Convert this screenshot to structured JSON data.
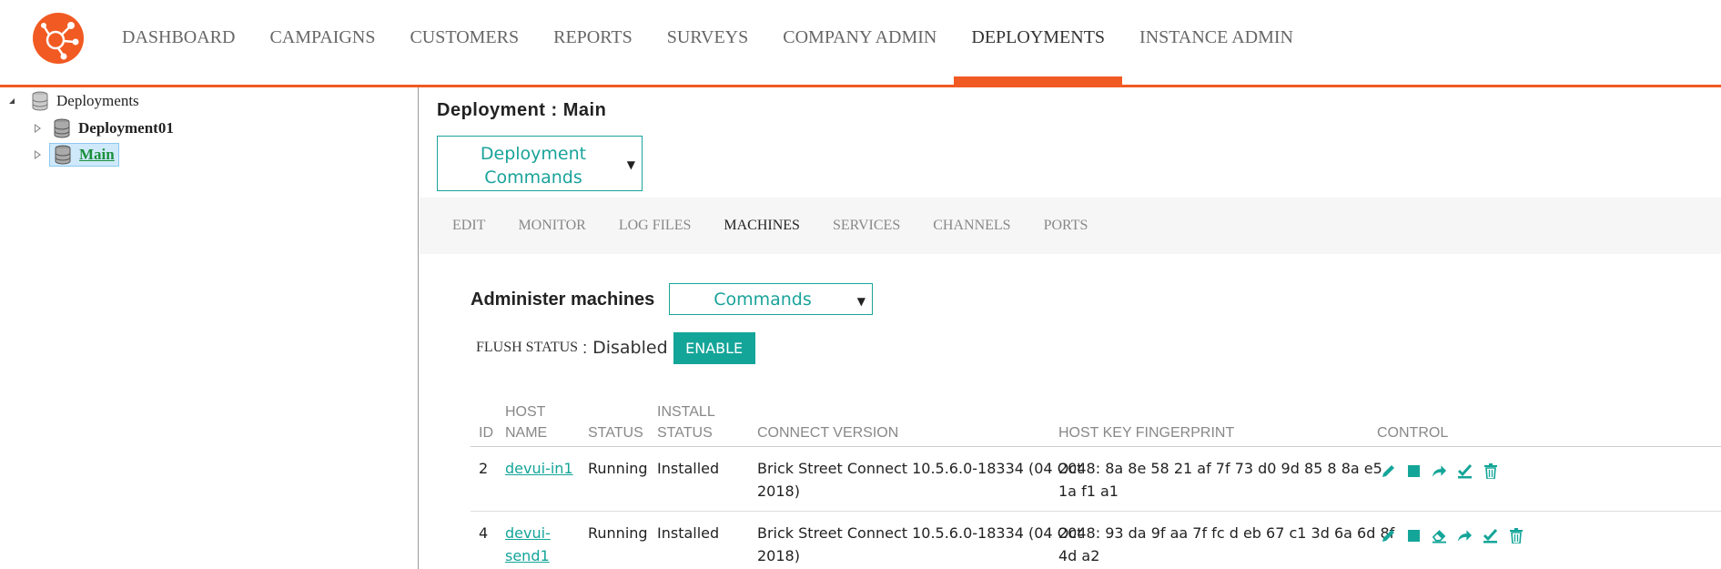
{
  "nav": {
    "items": [
      {
        "label": "DASHBOARD"
      },
      {
        "label": "CAMPAIGNS"
      },
      {
        "label": "CUSTOMERS"
      },
      {
        "label": "REPORTS"
      },
      {
        "label": "SURVEYS"
      },
      {
        "label": "COMPANY ADMIN"
      },
      {
        "label": "DEPLOYMENTS"
      },
      {
        "label": "INSTANCE ADMIN"
      }
    ],
    "active": "DEPLOYMENTS"
  },
  "tree": {
    "root": "Deployments",
    "children": [
      {
        "label": "Deployment01"
      },
      {
        "label": "Main"
      }
    ]
  },
  "main": {
    "title": "Deployment : Main",
    "deploy_dropdown": {
      "line1": "Deployment",
      "line2": "Commands"
    },
    "tabs": [
      {
        "label": "EDIT"
      },
      {
        "label": "MONITOR"
      },
      {
        "label": "LOG FILES"
      },
      {
        "label": "MACHINES"
      },
      {
        "label": "SERVICES"
      },
      {
        "label": "CHANNELS"
      },
      {
        "label": "PORTS"
      }
    ],
    "active_tab": "MACHINES",
    "admin_title": "Administer machines",
    "commands_dropdown": "Commands",
    "flush": {
      "label": "FLUSH STATUS",
      "colon": ":",
      "value": "Disabled",
      "button": "ENABLE"
    },
    "table": {
      "headers": {
        "id": "ID",
        "host_line1": "HOST",
        "host_line2": "NAME",
        "status": "STATUS",
        "install_line1": "INSTALL",
        "install_line2": "STATUS",
        "connect": "CONNECT VERSION",
        "fingerprint": "HOST KEY FINGERPRINT",
        "control": "CONTROL"
      },
      "rows": [
        {
          "id": "2",
          "host_line1": "devui-in1",
          "host_line2": "",
          "status": "Running",
          "install": "Installed",
          "connect_line1": "Brick Street Connect 10.5.6.0-18334 (04 Oct",
          "connect_line2": "2018)",
          "fp_line1": "2048: 8a 8e 58 21 af 7f 73 d0 9d 85 8 8a e5",
          "fp_line2": "1a f1 a1"
        },
        {
          "id": "4",
          "host_line1": "devui-",
          "host_line2": "send1",
          "status": "Running",
          "install": "Installed",
          "connect_line1": "Brick Street Connect 10.5.6.0-18334 (04 Oct",
          "connect_line2": "2018)",
          "fp_line1": "2048: 93 da 9f aa 7f fc d eb 67 c1 3d 6a 6d 8f",
          "fp_line2": "4d a2"
        }
      ]
    }
  },
  "colors": {
    "brand": "#f15a22",
    "accent": "#14a599",
    "selected_bg": "#cfe9fb"
  },
  "icons": [
    "logo-icon",
    "database-icon",
    "edit-icon",
    "stop-icon",
    "share-icon",
    "eraser-icon",
    "check-icon",
    "trash-icon"
  ]
}
